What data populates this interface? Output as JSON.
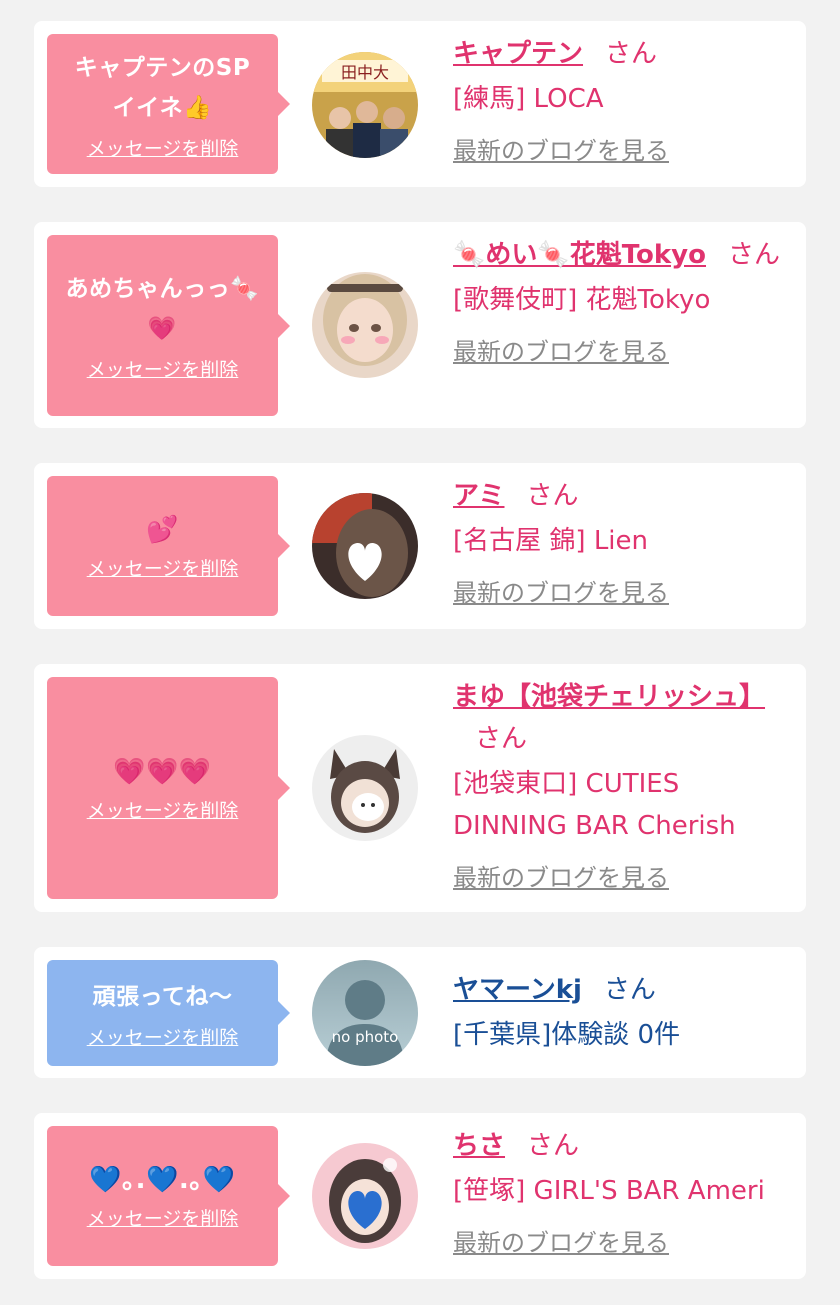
{
  "common": {
    "delete_label": "メッセージを削除",
    "san": "さん",
    "blog_label": "最新のブログを見る",
    "colors": {
      "pink_bubble": "#f98ea0",
      "blue_bubble": "#8db5ef",
      "pink_text": "#e0336e",
      "blue_text": "#1a4f96"
    }
  },
  "items": [
    {
      "message": "キャプテンのSP\nイイネ👍",
      "name": "キャプテン",
      "shop": "[練馬] LOCA",
      "has_blog": true,
      "bubble": "pink"
    },
    {
      "message": "あめちゃんっっ🍬\n💗",
      "name": "🍬めい🍬花魁Tokyo",
      "shop": "[歌舞伎町] 花魁Tokyo",
      "has_blog": true,
      "bubble": "pink"
    },
    {
      "message": "💕",
      "name": "アミ",
      "shop": "[名古屋 錦] Lien",
      "has_blog": true,
      "bubble": "pink"
    },
    {
      "message": "💗💗💗",
      "name": "まゆ【池袋チェリッシュ】",
      "shop": "[池袋東口] CUTIES DINNING BAR Cherish",
      "has_blog": true,
      "bubble": "pink"
    },
    {
      "message": "頑張ってね〜",
      "name": "ヤマーンkj",
      "shop": "[千葉県]体験談 0件",
      "has_blog": false,
      "bubble": "blue",
      "avatar_text": "no photo"
    },
    {
      "message": "💙｡.💙.｡💙",
      "name": "ちさ",
      "shop": "[笹塚] GIRL'S BAR Ameri",
      "has_blog": true,
      "bubble": "pink"
    }
  ]
}
